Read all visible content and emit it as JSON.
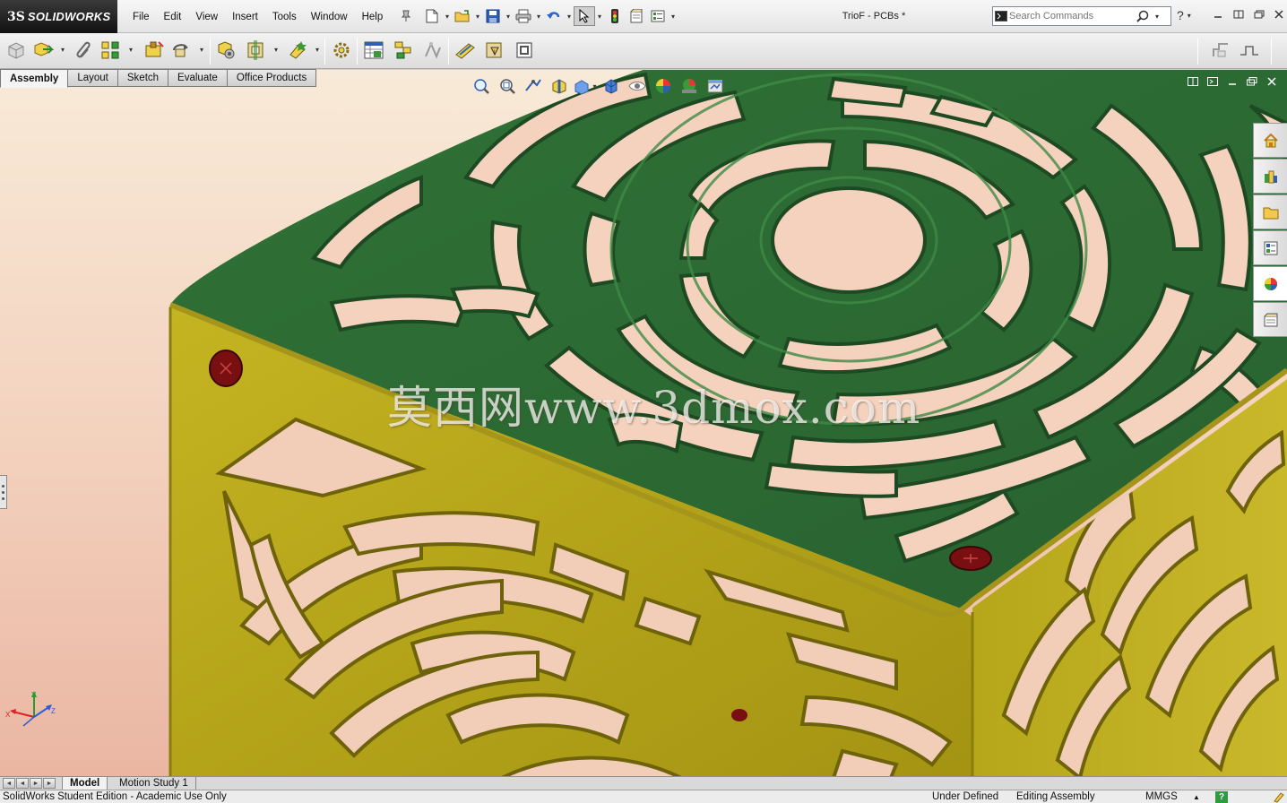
{
  "app": {
    "logo_ds": "3S",
    "logo_text": "SOLIDWORKS",
    "window_title": "TrioF - PCBs *"
  },
  "menu": [
    "File",
    "Edit",
    "View",
    "Insert",
    "Tools",
    "Window",
    "Help"
  ],
  "search": {
    "placeholder": "Search Commands"
  },
  "help": {
    "label": "?"
  },
  "tabs": [
    {
      "label": "Assembly",
      "active": true
    },
    {
      "label": "Layout",
      "active": false
    },
    {
      "label": "Sketch",
      "active": false
    },
    {
      "label": "Evaluate",
      "active": false
    },
    {
      "label": "Office Products",
      "active": false
    }
  ],
  "viewport": {
    "watermark": "莫西网www.3dmox.com"
  },
  "triad": {
    "x": "X",
    "y": "Y",
    "z": "Z"
  },
  "bottom_tabs": [
    {
      "label": "Model",
      "active": true
    },
    {
      "label": "Motion Study 1",
      "active": false
    }
  ],
  "status": {
    "edition": "SolidWorks Student Edition - Academic Use Only",
    "definition": "Under Defined",
    "mode": "Editing Assembly",
    "units": "MMGS",
    "units_arrow": "▲",
    "help": "?"
  },
  "colors": {
    "green_part": "#2e6b33",
    "yellow_part": "#b5a51a",
    "background_top": "#f8ead8",
    "background_bottom": "#eab6a2"
  }
}
